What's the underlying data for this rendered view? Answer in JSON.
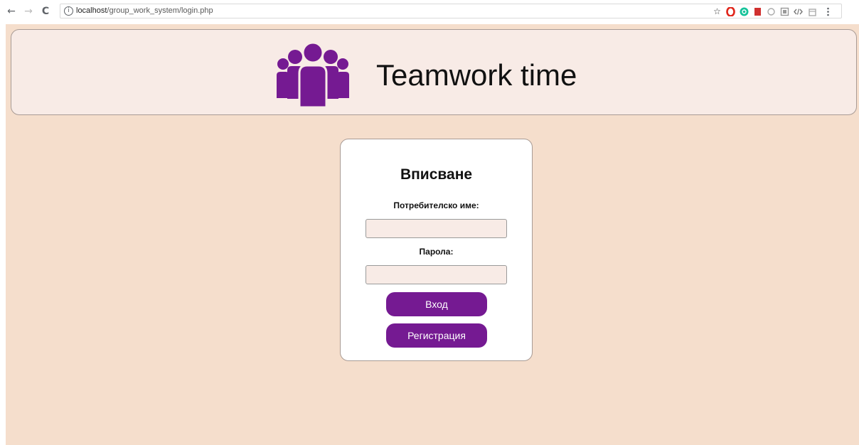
{
  "browser": {
    "back_icon": "←",
    "forward_icon": "→",
    "reload_icon": "C",
    "info_icon": "i",
    "url_host": "localhost",
    "url_path": "/group_work_system/login.php",
    "star_icon": "☆",
    "extensions": [
      "opera-icon",
      "grammarly-icon",
      "bookmark-ext-icon",
      "ext-circle-icon",
      "ext-square-icon",
      "code-ext-icon",
      "ext-box-icon",
      "menu-icon"
    ]
  },
  "header": {
    "title": "Teamwork time",
    "logo": "team-icon"
  },
  "login": {
    "title": "Вписване",
    "username_label": "Потребителско име:",
    "username_value": "",
    "password_label": "Парола:",
    "password_value": "",
    "login_button": "Вход",
    "register_button": "Регистрация"
  },
  "colors": {
    "page_bg": "#f5decc",
    "card_bg": "#f8ebe6",
    "accent": "#751a92"
  }
}
